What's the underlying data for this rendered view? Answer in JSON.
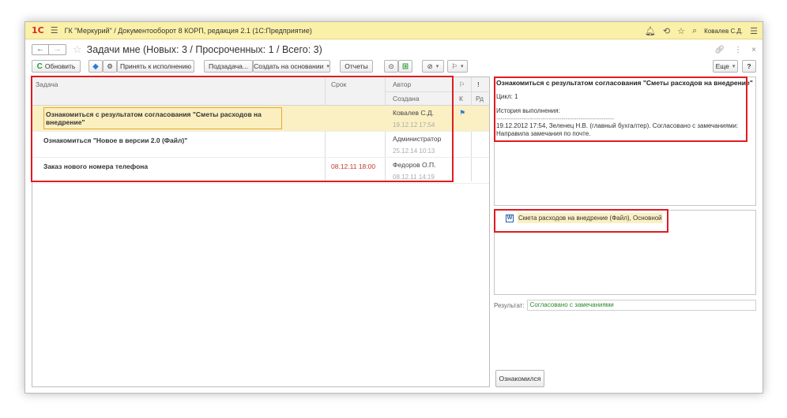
{
  "titlebar": {
    "logo": "1С",
    "app_title": "ГК \"Меркурий\" / Документооборот 8 КОРП, редакция 2.1  (1С:Предприятие)",
    "user": "Ковалев С.Д."
  },
  "form": {
    "back": "←",
    "forward": "→",
    "title": "Задачи мне (Новых: 3 / Просроченных: 1 / Всего: 3)"
  },
  "toolbar": {
    "refresh": "Обновить",
    "accept": "Принять к исполнению",
    "subtask": "Подзадача...",
    "create_based": "Создать на основании",
    "reports": "Отчеты",
    "more": "Еще",
    "help": "?"
  },
  "grid": {
    "headers": {
      "task": "Задача",
      "deadline": "Срок",
      "author": "Автор",
      "created": "Создана",
      "flag": "К",
      "priority": "Рд"
    },
    "rows": [
      {
        "subject": "Ознакомиться с результатом согласования \"Сметы расходов на внедрение\"",
        "deadline": "",
        "author": "Ковалев С.Д.",
        "created": "19.12.12 17:54",
        "flagged": true
      },
      {
        "subject": "Ознакомиться \"Новое в версии 2.0 (Файл)\"",
        "deadline": "",
        "author": "Администратор",
        "created": "25.12.14 10:13",
        "flagged": false
      },
      {
        "subject": "Заказ нового номера телефона",
        "deadline": "08.12.11 18:00",
        "author": "Федоров О.П.",
        "created": "08.12.11 14:19",
        "flagged": false
      }
    ]
  },
  "details": {
    "title": "Ознакомиться с результатом согласования \"Сметы расходов на внедрение\"",
    "cycle": "Цикл: 1",
    "history_label": "История выполнения:",
    "separator": "--------------------------------------------------------",
    "history_line1": "19.12.2012 17:54, Зеленец Н.В. (главный бухгалтер). Согласовано с замечаниями:",
    "history_line2": "Направила замечания по почте."
  },
  "attachment": {
    "icon": "W",
    "label": "Смета расходов на внедрение (Файл), Основной"
  },
  "result": {
    "label": "Результат:",
    "value": "Согласовано с замечаниями"
  },
  "ack_button": "Ознакомился",
  "colors": {
    "titlebar": "#fbf0a7",
    "selection": "#fbf0c4",
    "highlight_box": "#e11b22",
    "overdue": "#c0392b",
    "result_text": "#2a8a2a"
  }
}
